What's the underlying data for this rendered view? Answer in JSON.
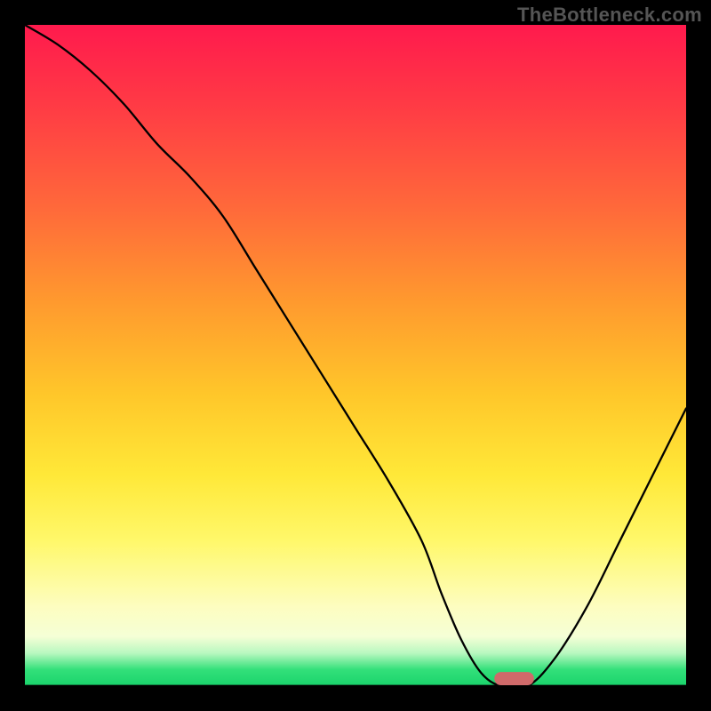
{
  "watermark": "TheBottleneck.com",
  "chart_data": {
    "type": "line",
    "title": "",
    "xlabel": "",
    "ylabel": "",
    "xlim": [
      0,
      100
    ],
    "ylim": [
      0,
      100
    ],
    "grid": false,
    "legend": false,
    "x": [
      0,
      5,
      10,
      15,
      20,
      25,
      30,
      35,
      40,
      45,
      50,
      55,
      60,
      63,
      66,
      69,
      72,
      76,
      80,
      85,
      90,
      95,
      100
    ],
    "values": [
      100,
      97,
      93,
      88,
      82,
      77,
      71,
      63,
      55,
      47,
      39,
      31,
      22,
      14,
      7,
      2,
      0,
      0,
      4,
      12,
      22,
      32,
      42
    ],
    "minimum_marker": {
      "x": 74,
      "y": 0,
      "width": 6,
      "height": 2,
      "color": "#d06a6a"
    },
    "background_gradient_stops": [
      {
        "pct": 0,
        "color": "#ff1a4d"
      },
      {
        "pct": 12,
        "color": "#ff3a45"
      },
      {
        "pct": 28,
        "color": "#ff6a3a"
      },
      {
        "pct": 42,
        "color": "#ff9a2e"
      },
      {
        "pct": 56,
        "color": "#ffc72a"
      },
      {
        "pct": 68,
        "color": "#ffe838"
      },
      {
        "pct": 78,
        "color": "#fff86a"
      },
      {
        "pct": 88,
        "color": "#fdfdc0"
      },
      {
        "pct": 92.5,
        "color": "#f5ffd6"
      },
      {
        "pct": 95,
        "color": "#b9f8c0"
      },
      {
        "pct": 97.5,
        "color": "#33e07a"
      },
      {
        "pct": 100,
        "color": "#19d36b"
      }
    ]
  }
}
